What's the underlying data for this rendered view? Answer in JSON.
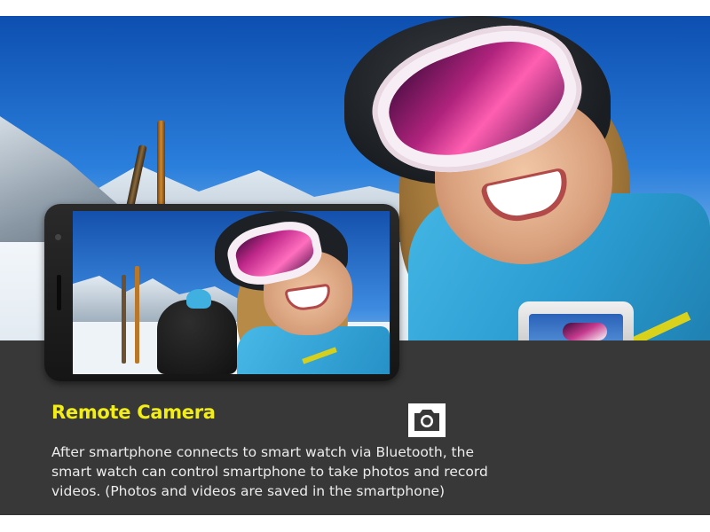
{
  "feature": {
    "title": "Remote Camera",
    "icon": "camera-icon",
    "description_lines": [
      "After smartphone connects to smart watch via Bluetooth, the",
      "smart watch can control smartphone to take photos and record",
      "videos. (Photos and videos are saved in the smartphone)"
    ]
  },
  "colors": {
    "title": "#f2ed17",
    "panel_background": "#383838",
    "body_text": "#ececec"
  }
}
